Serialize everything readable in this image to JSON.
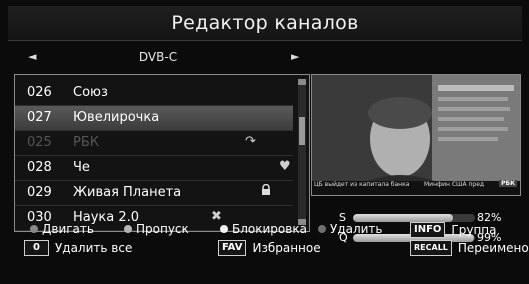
{
  "header": {
    "title": "Редактор каналов"
  },
  "selector": {
    "left_arrow": "◄",
    "label": "DVB-C",
    "right_arrow": "►"
  },
  "channels": [
    {
      "num": "026",
      "name": "Союз"
    },
    {
      "num": "027",
      "name": "Ювелирочка"
    },
    {
      "num": "025",
      "name": "РБК"
    },
    {
      "num": "028",
      "name": "Че"
    },
    {
      "num": "029",
      "name": "Живая Планета"
    },
    {
      "num": "030",
      "name": "Наука 2.0"
    }
  ],
  "signal": {
    "s_label": "S",
    "s_value": "82%",
    "s_level": 0.82,
    "q_label": "Q",
    "q_value": "99%",
    "q_level": 0.99
  },
  "legend": {
    "move": "Двигать",
    "skip": "Пропуск",
    "lock": "Блокировка",
    "delete": "Удалить",
    "info_key": "INFO",
    "group": "Группа",
    "zero_key": "0",
    "delete_all": "Удалить все",
    "fav_key": "FAV",
    "favorite": "Избранное",
    "recall_key": "RECALL",
    "rename": "Переименоват"
  },
  "preview": {
    "ticker_left": "ЦБ выйдет из капитала банка",
    "ticker_right": "Минфин США пред",
    "logo": "РБК"
  }
}
